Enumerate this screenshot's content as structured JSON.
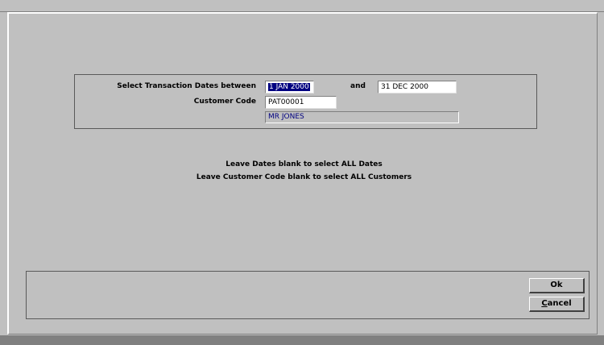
{
  "form": {
    "date_label": "Select Transaction Dates between",
    "date_from": "1 JAN 2000",
    "and_label": "and",
    "date_to": "31 DEC 2000",
    "customer_label": "Customer Code",
    "customer_code": "PAT00001",
    "customer_name": "MR JONES"
  },
  "hints": {
    "line1": "Leave Dates blank to select ALL Dates",
    "line2": "Leave Customer Code blank to select ALL Customers"
  },
  "buttons": {
    "ok_label": "Ok",
    "cancel_underline": "C",
    "cancel_rest": "ancel"
  },
  "colors": {
    "window_bg": "#c0c0c0",
    "selection_bg": "#000080",
    "readonly_text": "#000080"
  }
}
